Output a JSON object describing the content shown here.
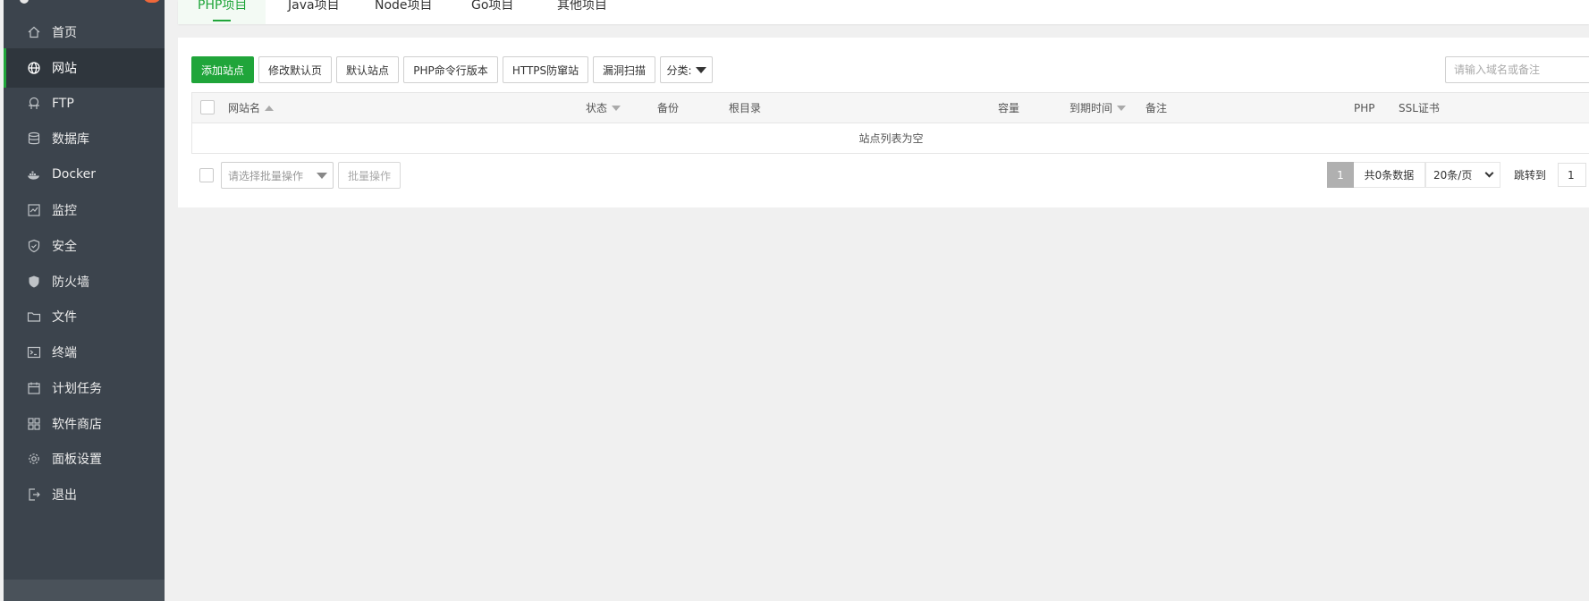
{
  "sidebar": {
    "items": [
      {
        "label": "首页",
        "icon": "home-icon"
      },
      {
        "label": "网站",
        "icon": "globe-icon",
        "active": true
      },
      {
        "label": "FTP",
        "icon": "ftp-icon"
      },
      {
        "label": "数据库",
        "icon": "database-icon"
      },
      {
        "label": "Docker",
        "icon": "docker-icon"
      },
      {
        "label": "监控",
        "icon": "monitor-icon"
      },
      {
        "label": "安全",
        "icon": "shield-icon"
      },
      {
        "label": "防火墙",
        "icon": "firewall-icon"
      },
      {
        "label": "文件",
        "icon": "folder-icon"
      },
      {
        "label": "终端",
        "icon": "terminal-icon"
      },
      {
        "label": "计划任务",
        "icon": "calendar-icon"
      },
      {
        "label": "软件商店",
        "icon": "apps-grid-icon"
      },
      {
        "label": "面板设置",
        "icon": "gear-icon"
      },
      {
        "label": "退出",
        "icon": "logout-icon"
      }
    ]
  },
  "tabs": [
    {
      "label": "PHP项目",
      "active": true
    },
    {
      "label": "Java项目"
    },
    {
      "label": "Node项目"
    },
    {
      "label": "Go项目"
    },
    {
      "label": "其他项目"
    }
  ],
  "toolbar": {
    "add_site": "添加站点",
    "edit_default_page": "修改默认页",
    "default_site": "默认站点",
    "php_cli_version": "PHP命令行版本",
    "https_protect": "HTTPS防窜站",
    "vuln_scan": "漏洞扫描",
    "category": "分类:",
    "search_placeholder": "请输入域名或备注"
  },
  "table": {
    "columns": [
      "网站名",
      "状态",
      "备份",
      "根目录",
      "容量",
      "到期时间",
      "备注",
      "PHP",
      "SSL证书"
    ],
    "empty_text": "站点列表为空"
  },
  "footer": {
    "batch_placeholder": "请选择批量操作",
    "batch_button": "批量操作",
    "current_page": "1",
    "total_text": "共0条数据",
    "page_size": "20条/页",
    "jump_label": "跳转到",
    "jump_value": "1"
  },
  "colors": {
    "accent": "#20a53a",
    "sidebar_bg": "#3c444d"
  }
}
